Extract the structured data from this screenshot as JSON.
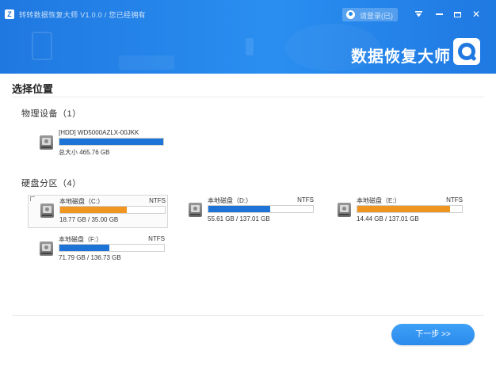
{
  "window": {
    "app_icon_letter": "Z",
    "title": "转转数据恢复大师 V1.0.0 / 您已经拥有",
    "login_label": "请登录(已)",
    "menu_icon": "dropdown-menu-icon",
    "min_icon": "minimize-icon",
    "max_icon": "maximize-icon",
    "close_label": "✕"
  },
  "banner": {
    "brand_name": "数据恢复大师"
  },
  "page": {
    "title": "选择位置"
  },
  "physical_devices": {
    "heading": "物理设备（1）",
    "items": [
      {
        "name": "[HDD] WD5000AZLX-00JKK",
        "fs": "",
        "size_text": "总大小 465.76 GB",
        "used_fraction": 1.0,
        "bar_color": "#1e74d6"
      }
    ]
  },
  "partitions": {
    "heading": "硬盘分区（4）",
    "items": [
      {
        "name": "本地磁盘（C:）",
        "fs": "NTFS",
        "size_text": "18.77 GB / 35.00 GB",
        "used_fraction": 0.64,
        "bar_color": "#f0951f"
      },
      {
        "name": "本地磁盘（D:）",
        "fs": "NTFS",
        "size_text": "55.61 GB / 137.01 GB",
        "used_fraction": 0.59,
        "bar_color": "#1e74d6"
      },
      {
        "name": "本地磁盘（E:）",
        "fs": "NTFS",
        "size_text": "14.44 GB / 137.01 GB",
        "used_fraction": 0.89,
        "bar_color": "#f0951f"
      },
      {
        "name": "本地磁盘（F:）",
        "fs": "NTFS",
        "size_text": "71.79 GB / 136.73 GB",
        "used_fraction": 0.48,
        "bar_color": "#1e74d6"
      }
    ]
  },
  "footer": {
    "next_label": "下一步 >>"
  }
}
